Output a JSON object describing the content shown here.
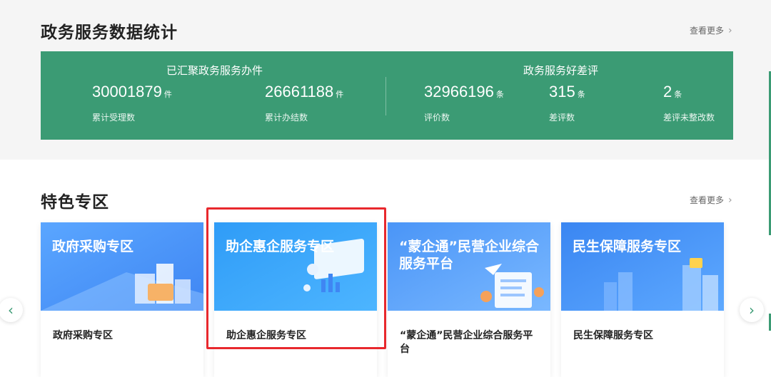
{
  "stats_section": {
    "title": "政务服务数据统计",
    "more_label": "查看更多",
    "groups": [
      {
        "title": "已汇聚政务服务办件"
      },
      {
        "title": "政务服务好差评"
      }
    ],
    "items": [
      {
        "value": "30001879",
        "unit": "件",
        "label": "累计受理数"
      },
      {
        "value": "26661188",
        "unit": "件",
        "label": "累计办结数"
      },
      {
        "value": "32966196",
        "unit": "条",
        "label": "评价数"
      },
      {
        "value": "315",
        "unit": "条",
        "label": "差评数"
      },
      {
        "value": "2",
        "unit": "条",
        "label": "差评未整改数"
      }
    ]
  },
  "feature_section": {
    "title": "特色专区",
    "more_label": "查看更多",
    "cards": [
      {
        "banner_text": "政府采购专区",
        "caption": "政府采购专区"
      },
      {
        "banner_text": "助企惠企服务专区",
        "caption": "助企惠企服务专区"
      },
      {
        "banner_text": "“蒙企通”民营企业综合服务平台",
        "caption": "“蒙企通”民营企业综合服务平台"
      },
      {
        "banner_text": "民生保障服务专区",
        "caption": "民生保障服务专区"
      }
    ]
  },
  "icons": {
    "prev": "chevron-left-icon",
    "next": "chevron-right-icon",
    "more": "chevron-right-icon"
  },
  "colors": {
    "accent_green": "#3b9b74",
    "highlight_red": "#e8282d",
    "banner_blue": "#3f8cf5"
  }
}
